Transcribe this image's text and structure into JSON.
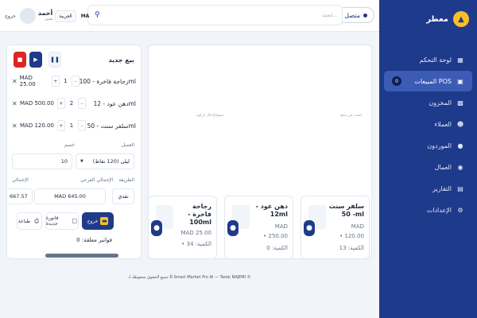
{
  "brand": {
    "name": "معطر"
  },
  "nav": [
    {
      "label": "لوحة التحكم",
      "icon": "dashboard-icon"
    },
    {
      "label": "المبيعات POS",
      "icon": "pos-icon",
      "badge": "0",
      "active": true
    },
    {
      "label": "المخزون",
      "icon": "inventory-icon"
    },
    {
      "label": "العملاء",
      "icon": "customers-icon"
    },
    {
      "label": "الموردون",
      "icon": "suppliers-icon"
    },
    {
      "label": "العمال",
      "icon": "workers-icon"
    },
    {
      "label": "التقارير",
      "icon": "reports-icon"
    },
    {
      "label": "الإعدادات",
      "icon": "settings-icon"
    }
  ],
  "header": {
    "status": "متصل",
    "search_placeholder": "ابحث...",
    "logout": "خروج",
    "user_name": "أحمد",
    "user_role": "مدير",
    "language": "العربية",
    "currency": "MA"
  },
  "products": {
    "placeholder_search": "ابحث عن منتج",
    "placeholder_barcode": "مسح/إدخال باركود",
    "items": [
      {
        "title": "سلفر سنت - 50ml",
        "currency": "MAD",
        "price": "120.00",
        "stock": "الكمية: 13"
      },
      {
        "title": "دهن عود - 12ml",
        "currency": "MAD",
        "price": "250.00",
        "stock": "الكمية: 0"
      },
      {
        "title": "رجاحة فاخرة - 100ml",
        "currency": "MAD",
        "price": "25.00",
        "stock": "الكمية: 34"
      }
    ],
    "price_prefix": "•",
    "stock_prefix": "•"
  },
  "cart": {
    "title": "بيع جديد",
    "lines": [
      {
        "name": "زجاجة فاخرة - 100ml",
        "qty": "1",
        "price": "MAD 25.00"
      },
      {
        "name": "دهن عود - 12ml",
        "qty": "2",
        "price": "MAD 500.00"
      },
      {
        "name": "سلفر سنت - 50ml",
        "qty": "1",
        "price": "MAD 120.00"
      }
    ],
    "customer_label": "العميل",
    "customer_value": "ليلى (120 نقاط)",
    "discount_label": "خصم",
    "discount_value": "10",
    "payment_label": "الطريقة",
    "payment_value": "نقدي",
    "subtotal_label": "الإجمالي الفرعي",
    "subtotal_value": "MAD 645.00",
    "total_label": "الإجمالي",
    "total_value": "667.57",
    "checkout_label": "خروج",
    "new_invoice_label": "فاتورة جديدة",
    "print_label": "طباعة",
    "pending": "فواتير معلقة: 0"
  },
  "footer": "جميع الحقوق محفوظة لـ E-Smart Market Pro AI — Tarek NAJEMI ©"
}
